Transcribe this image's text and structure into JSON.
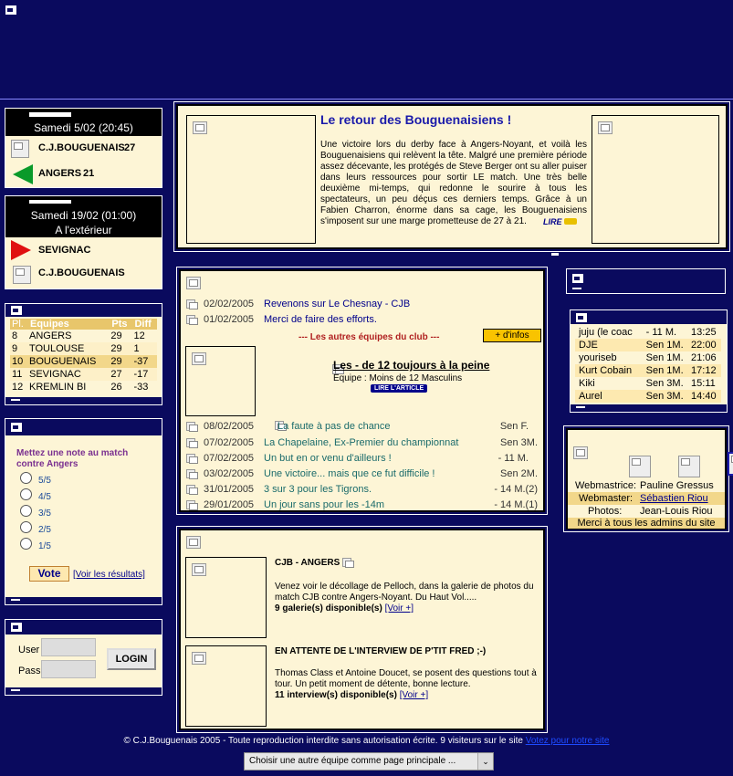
{
  "match_next": {
    "date": "Samedi 5/02 (20:45)",
    "home": "C.J.BOUGUENAIS",
    "home_score": "27",
    "away": "ANGERS",
    "away_score": "21"
  },
  "match_away": {
    "date": "Samedi 19/02 (01:00)",
    "location": "A l'extérieur",
    "team1": "SEVIGNAC",
    "team2": "C.J.BOUGUENAIS"
  },
  "standings": {
    "headers": [
      "Pl.",
      "Equipes",
      "Pts",
      "Diff"
    ],
    "rows": [
      [
        "8",
        "ANGERS",
        "29",
        "12"
      ],
      [
        "9",
        "TOULOUSE",
        "29",
        "1"
      ],
      [
        "10",
        "BOUGUENAIS",
        "29",
        "-37"
      ],
      [
        "11",
        "SEVIGNAC",
        "27",
        "-17"
      ],
      [
        "12",
        "KREMLIN BI",
        "26",
        "-33"
      ]
    ]
  },
  "poll": {
    "question": "Mettez une note au match contre Angers",
    "options": [
      "5/5",
      "4/5",
      "3/5",
      "2/5",
      "1/5"
    ],
    "vote_label": "Vote",
    "results_label": "[Voir les résultats]"
  },
  "login": {
    "user_label": "User",
    "pass_label": "Pass",
    "button_label": "LOGIN"
  },
  "headline": {
    "title": "Le retour des Bouguenaisiens !",
    "body": "Une victoire lors du derby face à Angers-Noyant, et voilà les Bouguenaisiens qui relèvent la tête. Malgré une première période assez décevante, les protégés de Steve Berger ont su aller puiser dans leurs ressources pour sortir LE match. Une très belle deuxième mi-temps, qui redonne le sourire à tous les spectateurs, un peu déçus ces derniers temps. Grâce à un Fabien Charron, énorme dans sa cage, les Bouguenaisiens s'imposent sur une marge prometteuse de 27 à 21.",
    "lire": "LIRE"
  },
  "news": {
    "items": [
      {
        "date": "02/02/2005",
        "title": "Revenons sur Le Chesnay - CJB"
      },
      {
        "date": "01/02/2005",
        "title": "Merci de faire des efforts."
      }
    ],
    "other_teams_label": "--- Les autres équipes du club ---",
    "infos_label": "+ d'infos",
    "feature": {
      "title": "Les - de 12 toujours à la peine",
      "team": "Equipe : Moins de 12 Masculins",
      "lire": "LIRE L'ARTICLE"
    },
    "team_items": [
      {
        "date": "08/02/2005",
        "title": "La faute à pas de chance",
        "team": "Sen F."
      },
      {
        "date": "07/02/2005",
        "title": "La Chapelaine, Ex-Premier du championnat",
        "team": "Sen 3M."
      },
      {
        "date": "07/02/2005",
        "title": "Un but en or venu d'ailleurs !",
        "team": "- 11 M."
      },
      {
        "date": "03/02/2005",
        "title": "Une victoire... mais que ce fut difficile !",
        "team": "Sen 2M."
      },
      {
        "date": "31/01/2005",
        "title": "3 sur 3 pour les Tigrons.",
        "team": "- 14 M.(2)"
      },
      {
        "date": "29/01/2005",
        "title": "Un jour sans pour les -14m",
        "team": "- 14 M.(1)"
      }
    ]
  },
  "galleries": {
    "g1": {
      "title": "CJB - ANGERS",
      "text": "Venez voir le décollage de Pelloch, dans la galerie de photos du match CJB contre Angers-Noyant. Du Haut Vol.....",
      "count": "9 galerie(s) disponible(s)",
      "more": "[Voir +]"
    },
    "g2": {
      "title": "EN ATTENTE DE L'INTERVIEW DE P'TIT FRED ;-)",
      "text": "Thomas Class et Antoine Doucet, se posent des questions tout à tour. Un petit moment de détente, bonne lecture.",
      "count": "11 interview(s) disponible(s)",
      "more": "[Voir +]"
    }
  },
  "online": {
    "rows": [
      [
        "juju (le coac",
        "- 11 M.",
        "13:25"
      ],
      [
        "DJE",
        "Sen 1M.",
        "22:00"
      ],
      [
        "youriseb",
        "Sen 1M.",
        "21:06"
      ],
      [
        "Kurt Cobain",
        "Sen 1M.",
        "17:12"
      ],
      [
        "Kiki",
        "Sen 3M.",
        "15:11"
      ],
      [
        "Aurel",
        "Sen 3M.",
        "14:40"
      ]
    ]
  },
  "credits": {
    "webmastrice_label": "Webmastrice:",
    "webmastrice": "Pauline Gressus",
    "webmaster_label": "Webmaster:",
    "webmaster": "Sébastien Riou",
    "photos_label": "Photos:",
    "photos": "Jean-Louis Riou",
    "thanks": "Merci à tous les admins du site"
  },
  "footer": {
    "text": "© C.J.Bouguenais 2005 - Toute reproduction interdite sans autorisation écrite. 9 visiteurs sur le site",
    "link": "Votez pour notre site",
    "select": "Choisir une autre équipe comme page principale ..."
  },
  "colors": {
    "navy": "#0a0a5e",
    "cream": "#fdf5d6",
    "gold": "#f2d78a",
    "link": "#00008b",
    "green_link": "#1a6b6b",
    "orange": "#f9c300"
  }
}
